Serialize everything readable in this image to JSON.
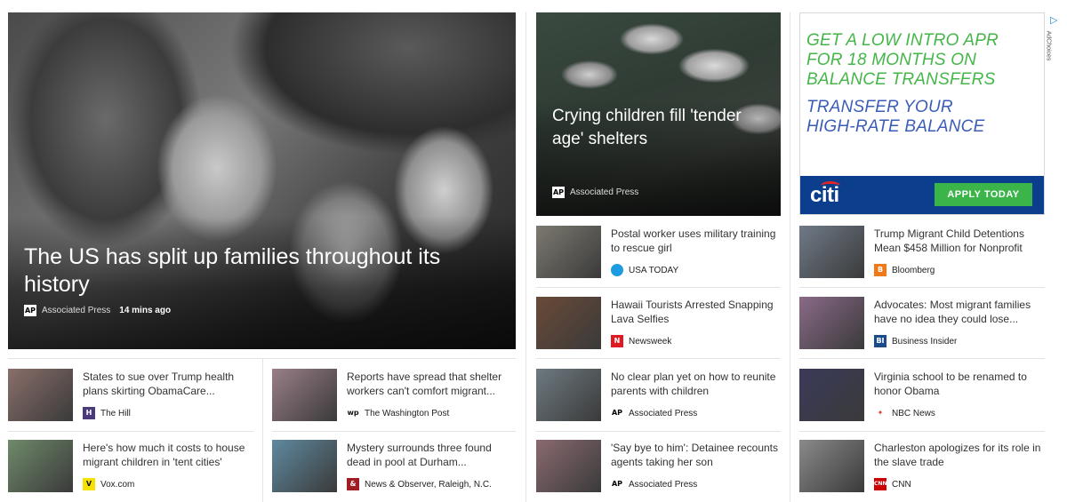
{
  "hero": {
    "title": "The US has split up families throughout its history",
    "source": "Associated Press",
    "time": "14 mins ago",
    "logo_text": "AP"
  },
  "feature": {
    "title": "Crying children fill 'tender age' shelters",
    "source": "Associated Press",
    "logo_text": "AP"
  },
  "ad": {
    "line1": "GET A LOW INTRO APR FOR 18 MONTHS ON BALANCE TRANSFERS",
    "line2": "TRANSFER YOUR HIGH-RATE BALANCE",
    "brand": "citi",
    "cta": "APPLY TODAY",
    "adchoices": "AdChoices"
  },
  "cards": [
    {
      "headline": "States to sue over Trump health plans skirting ObamaCare...",
      "source": "The Hill",
      "logo": "H",
      "logo_bg": "#4a3a7a",
      "logo_fg": "#ffffff",
      "thumb": "#8a6f6a"
    },
    {
      "headline": "Reports have spread that shelter workers can't comfort migrant...",
      "source": "The Washington Post",
      "logo": "wp",
      "logo_bg": "#ffffff",
      "logo_fg": "#111111",
      "thumb": "#9a7f88"
    },
    {
      "headline": "Postal worker uses military training to rescue girl",
      "source": "USA TODAY",
      "logo": "●",
      "logo_bg": "#1d9ce0",
      "logo_fg": "#1d9ce0",
      "thumb": "#7c7a70"
    },
    {
      "headline": "Trump Migrant Child Detentions Mean $458 Million for Nonprofit",
      "source": "Bloomberg",
      "logo": "B",
      "logo_bg": "#f07a1a",
      "logo_fg": "#ffffff",
      "thumb": "#6f7a88"
    },
    {
      "headline": "Here's how much it costs to house migrant children in 'tent cities'",
      "source": "Vox.com",
      "logo": "V",
      "logo_bg": "#f5e200",
      "logo_fg": "#111111",
      "thumb": "#6f8a6a"
    },
    {
      "headline": "Mystery surrounds three found dead in pool at Durham...",
      "source": "News & Observer, Raleigh, N.C.",
      "logo": "&",
      "logo_bg": "#a01e23",
      "logo_fg": "#ffffff",
      "thumb": "#5f8aa0"
    },
    {
      "headline": "Hawaii Tourists Arrested Snapping Lava Selfies",
      "source": "Newsweek",
      "logo": "N",
      "logo_bg": "#e01a22",
      "logo_fg": "#ffffff",
      "thumb": "#6a4a38"
    },
    {
      "headline": "Advocates: Most migrant families have no idea they could lose...",
      "source": "Business Insider",
      "logo": "BI",
      "logo_bg": "#1b4b8a",
      "logo_fg": "#ffffff",
      "thumb": "#8a6a88"
    },
    {
      "headline": "No clear plan yet on how to reunite parents with children",
      "source": "Associated Press",
      "logo": "AP",
      "logo_bg": "#ffffff",
      "logo_fg": "#000000",
      "thumb": "#6d7a80"
    },
    {
      "headline": "Virginia school to be renamed to honor Obama",
      "source": "NBC News",
      "logo": "✦",
      "logo_bg": "#ffffff",
      "logo_fg": "#d1442a",
      "thumb": "#3a3a5a"
    },
    {
      "headline": "'Say bye to him': Detainee recounts agents taking her son",
      "source": "Associated Press",
      "logo": "AP",
      "logo_bg": "#ffffff",
      "logo_fg": "#000000",
      "thumb": "#8a6a70"
    },
    {
      "headline": "Charleston apologizes for its role in the slave trade",
      "source": "CNN",
      "logo": "CNN",
      "logo_bg": "#cc0000",
      "logo_fg": "#ffffff",
      "thumb": "#8a8a8a"
    }
  ]
}
